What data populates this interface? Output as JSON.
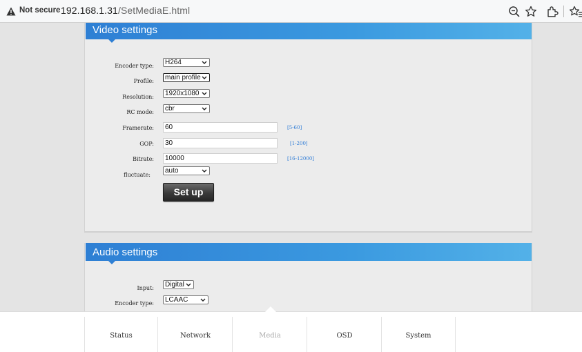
{
  "browser": {
    "security_label": "Not secure",
    "url_host": "192.168.1.31",
    "url_path": "/SetMediaE.html",
    "icons": [
      "warning-icon",
      "zoom-icon",
      "star-icon",
      "extensions-icon",
      "favorites-icon"
    ]
  },
  "video": {
    "title": "Video settings",
    "encoder_type": {
      "label": "Encoder type:",
      "value": "H264"
    },
    "profile": {
      "label": "Profile:",
      "value": "main profile"
    },
    "resolution": {
      "label": "Resolution:",
      "value": "1920x1080"
    },
    "rc_mode": {
      "label": "RC mode:",
      "value": "cbr"
    },
    "framerate": {
      "label": "Framerate:",
      "value": "60",
      "hint": "[5-60]"
    },
    "gop": {
      "label": "GOP:",
      "value": "30",
      "hint": "[1-200]"
    },
    "bitrate": {
      "label": "Bitrate:",
      "value": "10000",
      "hint": "[16-12000]"
    },
    "fluctuate": {
      "label": "fluctuate:",
      "value": "auto"
    },
    "setup_label": "Set up"
  },
  "audio": {
    "title": "Audio settings",
    "input": {
      "label": "Input:",
      "value": "Digital"
    },
    "encoder_type": {
      "label": "Encoder type:",
      "value": "LCAAC"
    }
  },
  "nav": {
    "items": [
      "Status",
      "Network",
      "Media",
      "OSD",
      "System"
    ],
    "active": "Media"
  },
  "colors": {
    "header_gradient_start": "#2e7fd4",
    "header_gradient_end": "#53b1e8",
    "hint": "#2d7bd6"
  }
}
